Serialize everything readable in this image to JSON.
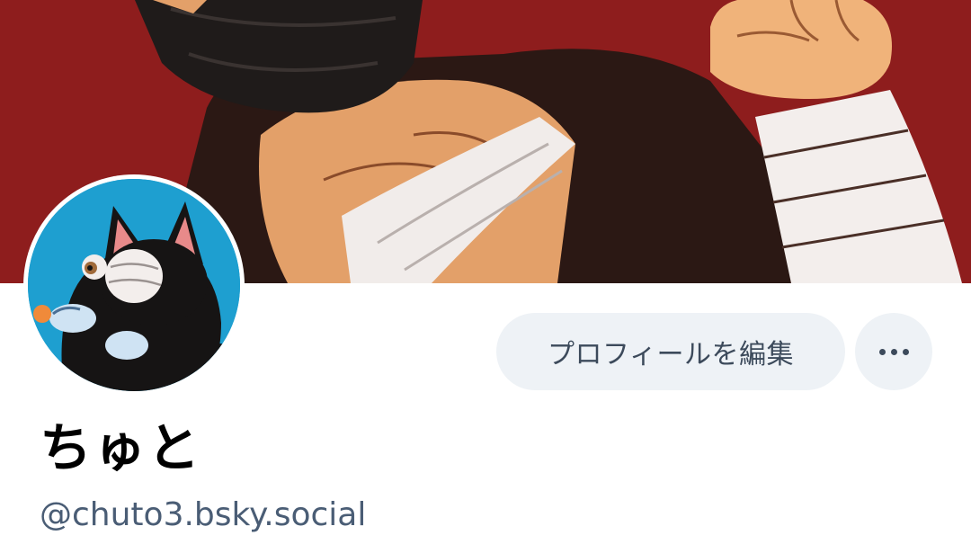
{
  "profile": {
    "display_name": "ちゅと",
    "handle": "@chuto3.bsky.social",
    "edit_profile_label": "プロフィールを編集",
    "more_icon": "ellipsis-icon",
    "banner_description": "",
    "avatar_description": ""
  },
  "colors": {
    "banner_background": "#8e1d1d",
    "avatar_background": "#1e9fd0",
    "button_background": "#eef2f6",
    "button_text": "#3c4a5b",
    "handle_text": "#4a5d75",
    "name_text": "#000000"
  }
}
